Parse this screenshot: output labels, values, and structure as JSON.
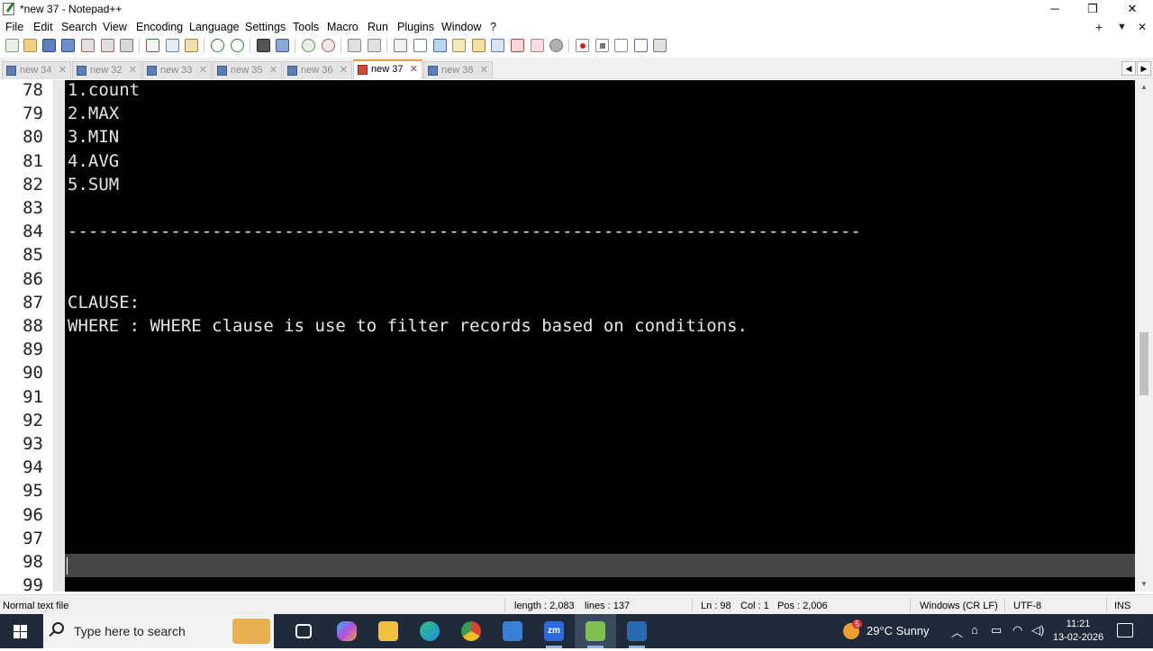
{
  "window": {
    "title": "*new 37 - Notepad++",
    "controls": {
      "minimize": "─",
      "restore": "❐",
      "close": "✕"
    }
  },
  "menu": {
    "items": [
      "File",
      "Edit",
      "Search",
      "View",
      "Encoding",
      "Language",
      "Settings",
      "Tools",
      "Macro",
      "Run",
      "Plugins",
      "Window",
      "?"
    ],
    "right": {
      "add": "+",
      "dropdown": "▼",
      "close": "✕"
    }
  },
  "tabs": [
    {
      "label": "new 34",
      "active": false
    },
    {
      "label": "new 32",
      "active": false
    },
    {
      "label": "new 33",
      "active": false
    },
    {
      "label": "new 35",
      "active": false
    },
    {
      "label": "new 36",
      "active": false
    },
    {
      "label": "new 37",
      "active": true
    },
    {
      "label": "new 38",
      "active": false
    }
  ],
  "editor": {
    "lines": [
      {
        "num": "78",
        "text": "1.count"
      },
      {
        "num": "79",
        "text": "2.MAX"
      },
      {
        "num": "80",
        "text": "3.MIN"
      },
      {
        "num": "81",
        "text": "4.AVG"
      },
      {
        "num": "82",
        "text": "5.SUM"
      },
      {
        "num": "83",
        "text": ""
      },
      {
        "num": "84",
        "text": "-----------------------------------------------------------------------------"
      },
      {
        "num": "85",
        "text": ""
      },
      {
        "num": "86",
        "text": ""
      },
      {
        "num": "87",
        "text": "CLAUSE:"
      },
      {
        "num": "88",
        "text": "WHERE : WHERE clause is use to filter records based on conditions."
      },
      {
        "num": "89",
        "text": ""
      },
      {
        "num": "90",
        "text": ""
      },
      {
        "num": "91",
        "text": ""
      },
      {
        "num": "92",
        "text": ""
      },
      {
        "num": "93",
        "text": ""
      },
      {
        "num": "94",
        "text": ""
      },
      {
        "num": "95",
        "text": ""
      },
      {
        "num": "96",
        "text": ""
      },
      {
        "num": "97",
        "text": ""
      },
      {
        "num": "98",
        "text": ""
      },
      {
        "num": "99",
        "text": ""
      }
    ],
    "current_line": "98"
  },
  "status": {
    "filetype": "Normal text file",
    "length": "length : 2,083",
    "lines": "lines : 137",
    "ln": "Ln : 98",
    "col": "Col : 1",
    "pos": "Pos : 2,006",
    "eol": "Windows (CR LF)",
    "encoding": "UTF-8",
    "mode": "INS"
  },
  "taskbar": {
    "search_placeholder": "Type here to search",
    "weather": {
      "temp": "29°C",
      "condition": "Sunny",
      "badge": "5"
    },
    "clock": {
      "time": "11:21",
      "date": "13-02-2026"
    },
    "apps": [
      {
        "name": "task-view",
        "color": "#1f2a3a"
      },
      {
        "name": "copilot",
        "color": "#7a5cf0"
      },
      {
        "name": "file-explorer",
        "color": "#f0c040"
      },
      {
        "name": "edge",
        "color": "#1e8fd8"
      },
      {
        "name": "chrome",
        "color": "#e04030"
      },
      {
        "name": "store",
        "color": "#3a7fd8"
      },
      {
        "name": "zoom",
        "color": "#2d6ce0"
      },
      {
        "name": "notepadpp",
        "color": "#80c050"
      },
      {
        "name": "vscode-like",
        "color": "#2a6ab0"
      }
    ]
  },
  "colors": {
    "editor_bg": "#000000",
    "current_line": "#464646",
    "active_tab_accent": "#f39c3c",
    "taskbar": "#1f2a3a"
  }
}
